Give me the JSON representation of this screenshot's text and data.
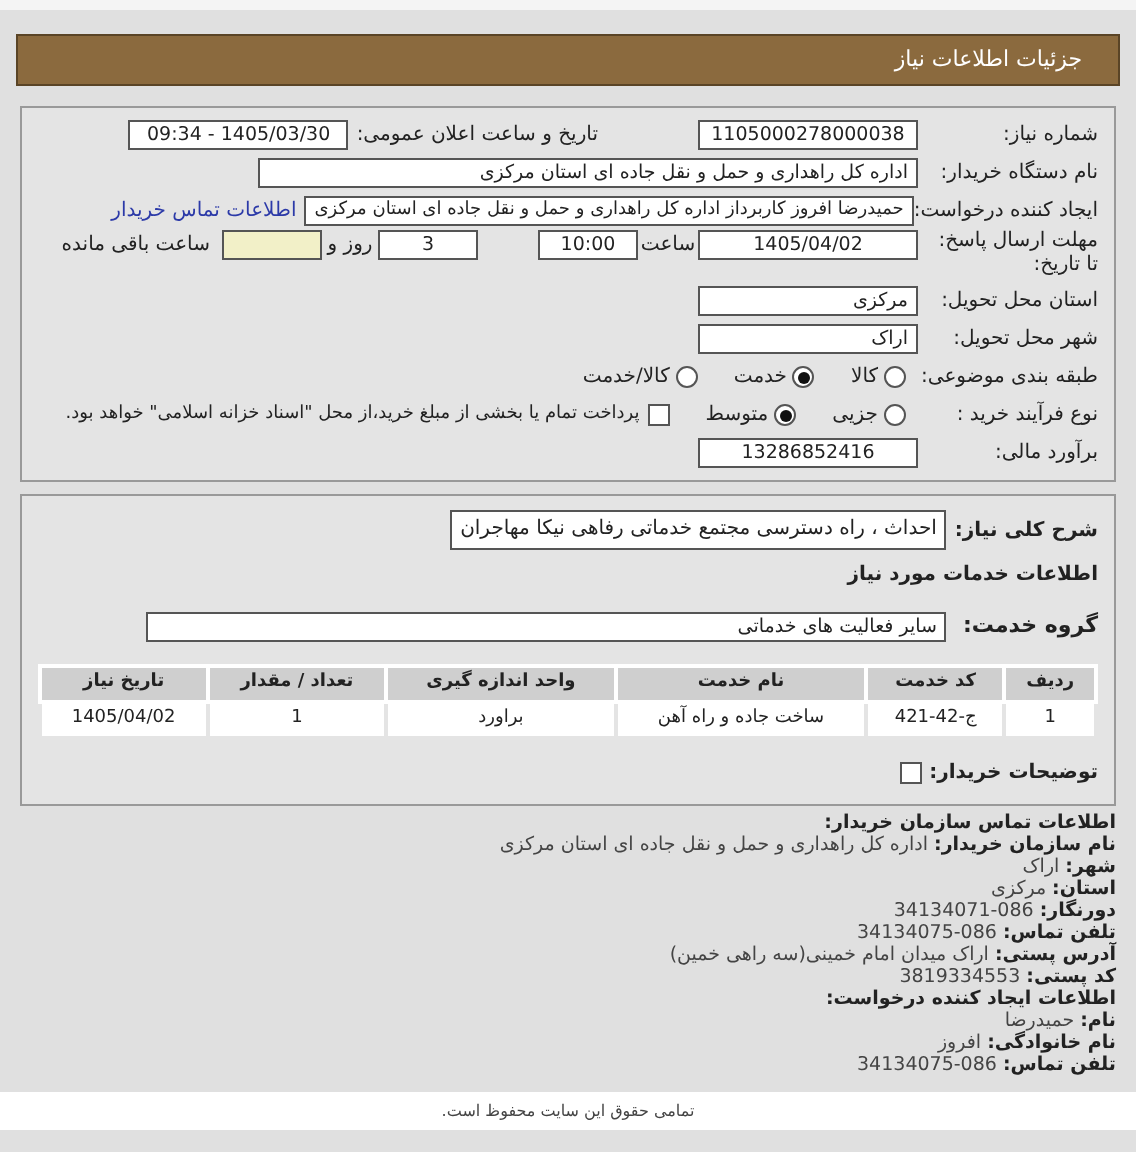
{
  "header": {
    "title": "جزئیات اطلاعات نیاز"
  },
  "details": {
    "need_number": {
      "label": "شماره نیاز:",
      "value": "1105000278000038"
    },
    "announce_datetime": {
      "label": "تاریخ و ساعت اعلان عمومی:",
      "value": "1405/03/30 - 09:34"
    },
    "buyer_org": {
      "label": "نام دستگاه خریدار:",
      "value": "اداره کل راهداری و حمل و نقل جاده ای استان مرکزی"
    },
    "requester": {
      "label": "ایجاد کننده درخواست:",
      "value": "حمیدرضا  افروز  کاربرداز اداره کل راهداری و حمل و نقل جاده ای استان مرکزی",
      "link": "اطلاعات تماس خریدار"
    },
    "deadline": {
      "label": "مهلت ارسال پاسخ: تا تاریخ:",
      "date": "1405/04/02",
      "time_label": "ساعت",
      "time": "10:00",
      "days": "3",
      "days_label": "روز و",
      "remaining_label": "ساعت باقی مانده"
    },
    "delivery_province": {
      "label": "استان محل تحویل:",
      "value": "مرکزی"
    },
    "delivery_city": {
      "label": "شهر محل تحویل:",
      "value": "اراک"
    },
    "category": {
      "label": "طبقه بندی موضوعی:",
      "options": [
        {
          "label": "کالا",
          "selected": false
        },
        {
          "label": "خدمت",
          "selected": true
        },
        {
          "label": "کالا/خدمت",
          "selected": false
        }
      ]
    },
    "purchase_type": {
      "label": "نوع فرآیند خرید :",
      "options": [
        {
          "label": "جزیی",
          "selected": false
        },
        {
          "label": "متوسط",
          "selected": true
        }
      ],
      "payment_note": {
        "checked": false,
        "text": "پرداخت تمام یا بخشی از مبلغ خرید،از محل \"اسناد خزانه اسلامی\" خواهد بود."
      }
    },
    "budget": {
      "label": "برآورد مالی:",
      "value": "13286852416"
    }
  },
  "services": {
    "summary": {
      "label": "شرح کلی نیاز:",
      "value": "احداث ، راه دسترسی مجتمع خدماتی رفاهی نیکا مهاجران"
    },
    "heading": "اطلاعات خدمات مورد نیاز",
    "service_group": {
      "label": "گروه خدمت:",
      "value": "سایر فعالیت های خدماتی"
    },
    "table": {
      "columns": [
        "ردیف",
        "کد خدمت",
        "نام خدمت",
        "واحد اندازه گیری",
        "تعداد / مقدار",
        "تاریخ نیاز"
      ],
      "rows": [
        [
          "1",
          "ج-42-421",
          "ساخت جاده و راه آهن",
          "براورد",
          "1",
          "1405/04/02"
        ]
      ]
    },
    "buyer_notes": {
      "label": "توضیحات خریدار:",
      "checked": false
    }
  },
  "contact": {
    "title": "اطلاعات تماس سازمان خریدار:",
    "lines": [
      {
        "label": "نام سازمان خریدار:",
        "value": "اداره کل راهداری و حمل و نقل جاده ای استان مرکزی"
      },
      {
        "label": "شهر:",
        "value": "اراک"
      },
      {
        "label": "استان:",
        "value": "مرکزی"
      },
      {
        "label": "دورنگار:",
        "value": "34134071-086"
      },
      {
        "label": "تلفن تماس:",
        "value": "34134075-086"
      },
      {
        "label": "آدرس پستی:",
        "value": "اراک میدان امام خمینی(سه راهی خمین)"
      },
      {
        "label": "کد پستی:",
        "value": "3819334553"
      }
    ]
  },
  "creator": {
    "title": "اطلاعات ایجاد کننده درخواست:",
    "lines": [
      {
        "label": "نام:",
        "value": "حمیدرضا"
      },
      {
        "label": "نام خانوادگی:",
        "value": "افروز"
      },
      {
        "label": "تلفن تماس:",
        "value": "34134075-086"
      }
    ]
  },
  "footer": {
    "text": "تمامی حقوق این سایت محفوظ است."
  }
}
